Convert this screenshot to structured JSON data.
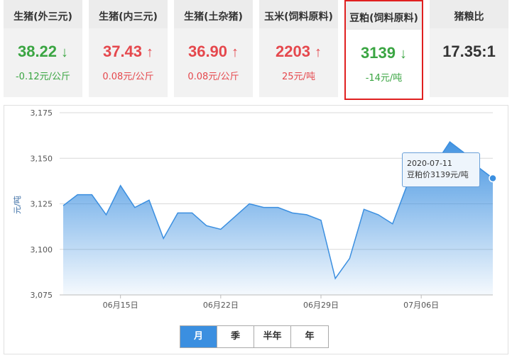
{
  "cards": [
    {
      "title": "生猪(外三元)",
      "price": "38.22",
      "direction": "down",
      "arrow": "↓",
      "change": "-0.12元/公斤"
    },
    {
      "title": "生猪(内三元)",
      "price": "37.43",
      "direction": "up",
      "arrow": "↑",
      "change": "0.08元/公斤"
    },
    {
      "title": "生猪(土杂猪)",
      "price": "36.90",
      "direction": "up",
      "arrow": "↑",
      "change": "0.08元/公斤"
    },
    {
      "title": "玉米(饲料原料)",
      "price": "2203",
      "direction": "up",
      "arrow": "↑",
      "change": "25元/吨"
    },
    {
      "title": "豆粕(饲料原料)",
      "price": "3139",
      "direction": "down",
      "arrow": "↓",
      "change": "-14元/吨"
    },
    {
      "title": "猪粮比",
      "price": "17.35:1",
      "direction": "neutral",
      "arrow": "",
      "change": ""
    }
  ],
  "colors": {
    "up": "#e5484d",
    "down": "#3aa542",
    "accent": "#3b8fe0",
    "active_border": "#e02020"
  },
  "chart_data": {
    "type": "area",
    "ylabel": "元/吨",
    "ylim": [
      3075,
      3175
    ],
    "y_ticks": [
      "3,175",
      "3,150",
      "3,125",
      "3,100",
      "3,075"
    ],
    "x_tick_labels": [
      "06月15日",
      "06月22日",
      "06月29日",
      "07月06日"
    ],
    "x": [
      "2020-06-11",
      "2020-06-12",
      "2020-06-13",
      "2020-06-14",
      "2020-06-15",
      "2020-06-16",
      "2020-06-17",
      "2020-06-18",
      "2020-06-19",
      "2020-06-20",
      "2020-06-21",
      "2020-06-22",
      "2020-06-23",
      "2020-06-24",
      "2020-06-25",
      "2020-06-26",
      "2020-06-27",
      "2020-06-28",
      "2020-06-29",
      "2020-06-30",
      "2020-07-01",
      "2020-07-02",
      "2020-07-03",
      "2020-07-04",
      "2020-07-05",
      "2020-07-06",
      "2020-07-07",
      "2020-07-08",
      "2020-07-09",
      "2020-07-10",
      "2020-07-11"
    ],
    "values": [
      3124,
      3130,
      3130,
      3119,
      3135,
      3123,
      3127,
      3106,
      3120,
      3120,
      3113,
      3111,
      3118,
      3125,
      3123,
      3123,
      3120,
      3119,
      3116,
      3084,
      3095,
      3122,
      3119,
      3114,
      3135,
      3140,
      3147,
      3159,
      3153,
      3145,
      3139
    ],
    "grid": true,
    "line_color": "#3b8fe0"
  },
  "tooltip": {
    "date": "2020-07-11",
    "text": "豆粕价3139元/吨"
  },
  "tabs": [
    "月",
    "季",
    "半年",
    "年"
  ],
  "active_tab": 0
}
